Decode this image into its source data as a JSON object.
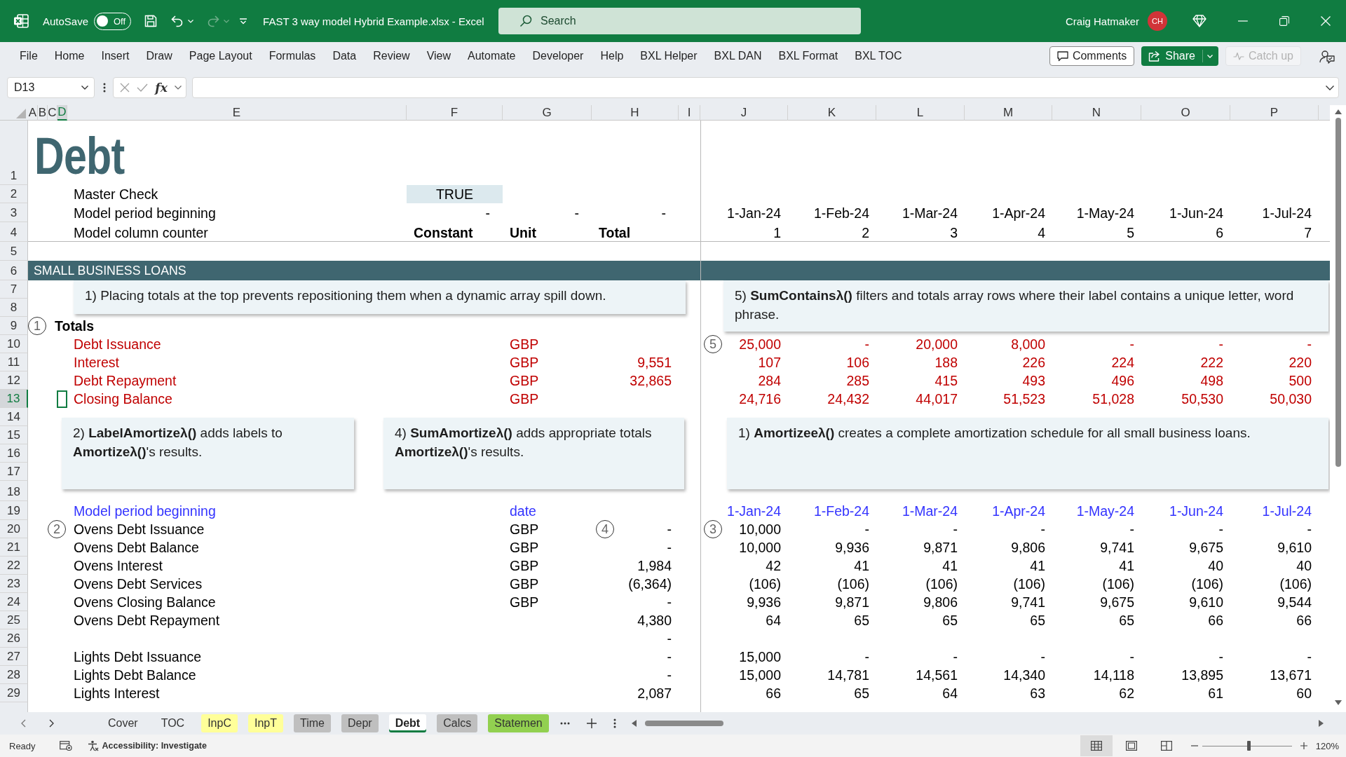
{
  "title_bar": {
    "autosave_label": "AutoSave",
    "autosave": {
      "on": false,
      "label": "Off"
    },
    "quick_access": [
      {
        "kind": "save",
        "disabled": false
      },
      {
        "kind": "undo",
        "disabled": false
      },
      {
        "kind": "redo",
        "disabled": true
      },
      {
        "kind": "customize",
        "disabled": false
      }
    ],
    "title": "FAST 3 way model Hybrid Example.xlsx - Excel",
    "search": {
      "placeholder": "Search"
    },
    "user": "Craig Hatmaker",
    "avatar": "CH"
  },
  "menu": {
    "tabs": [
      "File",
      "Home",
      "Insert",
      "Draw",
      "Page Layout",
      "Formulas",
      "Data",
      "Review",
      "View",
      "Automate",
      "Developer",
      "Help",
      "BXL Helper",
      "BXL DAN",
      "BXL Format",
      "BXL TOC"
    ],
    "buttons": [
      {
        "kind": "comments",
        "label": "Comments",
        "disabled": false
      },
      {
        "kind": "share",
        "label": "Share",
        "disabled": false
      },
      {
        "kind": "catch-up",
        "label": "Catch up",
        "disabled": true
      }
    ]
  },
  "formula_bar": {
    "name_box": "D13",
    "function_label": "fx",
    "editing": false
  },
  "sheet": {
    "columns": [
      {
        "label": "A",
        "selected": false
      },
      {
        "label": "B",
        "selected": false
      },
      {
        "label": "C",
        "selected": false
      },
      {
        "label": "D",
        "selected": true
      },
      {
        "label": "E",
        "selected": false
      },
      {
        "label": "F",
        "selected": false
      },
      {
        "label": "G",
        "selected": false
      },
      {
        "label": "H",
        "selected": false
      },
      {
        "label": "I",
        "selected": false
      },
      {
        "label": "J",
        "selected": false
      },
      {
        "label": "K",
        "selected": false
      },
      {
        "label": "L",
        "selected": false
      },
      {
        "label": "M",
        "selected": false
      },
      {
        "label": "N",
        "selected": false
      },
      {
        "label": "O",
        "selected": false
      },
      {
        "label": "P",
        "selected": false
      }
    ],
    "rows": [
      {
        "number": "1",
        "kind": "title",
        "selected": false,
        "label": "Debt"
      },
      {
        "number": "2",
        "kind": "check",
        "selected": false,
        "label": "Master Check",
        "constant": "TRUE"
      },
      {
        "number": "3",
        "kind": "dates",
        "selected": false,
        "label": "Model period beginning",
        "lead_values": [
          "-",
          "-",
          "-"
        ],
        "values": [
          "1-Jan-24",
          "1-Feb-24",
          "1-Mar-24",
          "1-Apr-24",
          "1-May-24",
          "1-Jun-24",
          "1-Jul-24"
        ]
      },
      {
        "number": "4",
        "kind": "header",
        "selected": false,
        "label": "Model column counter",
        "headings": [
          "Constant",
          "Unit",
          "Total"
        ],
        "values": [
          "1",
          "2",
          "3",
          "4",
          "5",
          "6",
          "7"
        ]
      },
      {
        "number": "5",
        "kind": "blank",
        "selected": false
      },
      {
        "number": "6",
        "kind": "band",
        "selected": false,
        "label": "SMALL BUSINESS LOANS"
      },
      {
        "number": "7",
        "kind": "notes",
        "selected": false,
        "notes": [
          {
            "text": "1) Placing totals at the top prevents repositioning them when a dynamic array spill down."
          },
          {
            "text": "5) **SumContainsλ()** filters and totals array rows where their label contains a unique letter, word\nphrase."
          }
        ]
      },
      {
        "number": "8",
        "kind": "blank",
        "selected": false
      },
      {
        "number": "9",
        "kind": "heading",
        "selected": false,
        "label": "Totals",
        "marker": "1"
      },
      {
        "number": "10",
        "kind": "total",
        "selected": false,
        "label": "Debt Issuance",
        "unit": "GBP",
        "values": [
          "25,000",
          "-",
          "20,000",
          "8,000",
          "-",
          "-",
          "-"
        ],
        "values_marker": "5"
      },
      {
        "number": "11",
        "kind": "total",
        "selected": false,
        "label": "Interest",
        "unit": "GBP",
        "total": "9,551",
        "values": [
          "107",
          "106",
          "188",
          "226",
          "224",
          "222",
          "220"
        ]
      },
      {
        "number": "12",
        "kind": "total",
        "selected": false,
        "label": "Debt Repayment",
        "unit": "GBP",
        "total": "32,865",
        "values": [
          "284",
          "285",
          "415",
          "493",
          "496",
          "498",
          "500"
        ]
      },
      {
        "number": "13",
        "kind": "total",
        "selected": true,
        "label": "Closing Balance",
        "unit": "GBP",
        "values": [
          "24,716",
          "24,432",
          "44,017",
          "51,523",
          "51,028",
          "50,530",
          "50,030"
        ]
      },
      {
        "number": "14",
        "kind": "notes",
        "selected": false,
        "notes": [
          {
            "text": "2) **LabelAmortizeλ()** adds labels to\n**Amortizeλ()**'s results."
          },
          {
            "text": "4) **SumAmortizeλ()** adds appropriate totals\n**Amortizeλ()**'s results."
          },
          {
            "text": "1) **Amortizeeλ()** creates a complete amortization schedule for all small business loans."
          }
        ]
      },
      {
        "number": "15",
        "kind": "blank",
        "selected": false
      },
      {
        "number": "16",
        "kind": "blank",
        "selected": false
      },
      {
        "number": "17",
        "kind": "blank",
        "selected": false
      },
      {
        "number": "18",
        "kind": "blank",
        "selected": false
      },
      {
        "number": "19",
        "kind": "timeline",
        "selected": false,
        "label": "Model period beginning",
        "unit": "date",
        "values": [
          "1-Jan-24",
          "1-Feb-24",
          "1-Mar-24",
          "1-Apr-24",
          "1-May-24",
          "1-Jun-24",
          "1-Jul-24"
        ]
      },
      {
        "number": "20",
        "kind": "line",
        "selected": false,
        "label": "Ovens Debt Issuance",
        "unit": "GBP",
        "total": "-",
        "values": [
          "10,000",
          "-",
          "-",
          "-",
          "-",
          "-",
          "-"
        ],
        "marker": "2",
        "total_marker": "4",
        "values_marker": "3"
      },
      {
        "number": "21",
        "kind": "line",
        "selected": false,
        "label": "Ovens Debt Balance",
        "unit": "GBP",
        "total": "-",
        "values": [
          "10,000",
          "9,936",
          "9,871",
          "9,806",
          "9,741",
          "9,675",
          "9,610"
        ]
      },
      {
        "number": "22",
        "kind": "line",
        "selected": false,
        "label": "Ovens Interest",
        "unit": "GBP",
        "total": "1,984",
        "values": [
          "42",
          "41",
          "41",
          "41",
          "41",
          "40",
          "40"
        ]
      },
      {
        "number": "23",
        "kind": "line",
        "selected": false,
        "label": "Ovens Debt Services",
        "unit": "GBP",
        "total": "(6,364)",
        "values": [
          "(106)",
          "(106)",
          "(106)",
          "(106)",
          "(106)",
          "(106)",
          "(106)"
        ]
      },
      {
        "number": "24",
        "kind": "line",
        "selected": false,
        "label": "Ovens Closing Balance",
        "unit": "GBP",
        "total": "-",
        "values": [
          "9,936",
          "9,871",
          "9,806",
          "9,741",
          "9,675",
          "9,610",
          "9,544"
        ]
      },
      {
        "number": "25",
        "kind": "line",
        "selected": false,
        "label": "Ovens Debt Repayment",
        "total": "4,380",
        "values": [
          "64",
          "65",
          "65",
          "65",
          "65",
          "66",
          "66"
        ]
      },
      {
        "number": "26",
        "kind": "line",
        "selected": false,
        "total": "-"
      },
      {
        "number": "27",
        "kind": "line",
        "selected": false,
        "label": "Lights Debt Issuance",
        "total": "-",
        "values": [
          "15,000",
          "-",
          "-",
          "-",
          "-",
          "-",
          "-"
        ]
      },
      {
        "number": "28",
        "kind": "line",
        "selected": false,
        "label": "Lights Debt Balance",
        "total": "-",
        "values": [
          "15,000",
          "14,781",
          "14,561",
          "14,340",
          "14,118",
          "13,895",
          "13,671"
        ]
      },
      {
        "number": "29",
        "kind": "line",
        "selected": false,
        "label": "Lights Interest",
        "total": "2,087",
        "values": [
          "66",
          "65",
          "64",
          "63",
          "62",
          "61",
          "60"
        ]
      }
    ]
  },
  "sheet_tabs": [
    {
      "label": "Cover",
      "selected": false
    },
    {
      "label": "TOC",
      "selected": false
    },
    {
      "label": "InpC",
      "selected": false,
      "color": "#ffff99"
    },
    {
      "label": "InpT",
      "selected": false,
      "color": "#ffff99"
    },
    {
      "label": "Time",
      "selected": false,
      "color": "#bfbfbf"
    },
    {
      "label": "Depr",
      "selected": false,
      "color": "#bfbfbf"
    },
    {
      "label": "Debt",
      "selected": true
    },
    {
      "label": "Calcs",
      "selected": false,
      "color": "#bfbfbf"
    },
    {
      "label": "Statemen",
      "selected": false,
      "color": "#92d050"
    }
  ],
  "status_bar": {
    "status": "Ready",
    "accessibility": "Accessibility: Investigate",
    "views": [
      {
        "kind": "normal",
        "selected": true
      },
      {
        "kind": "page-layout",
        "selected": false
      },
      {
        "kind": "page-break",
        "selected": false
      }
    ],
    "zoom": {
      "level": 0.52,
      "reading": "120%"
    }
  }
}
